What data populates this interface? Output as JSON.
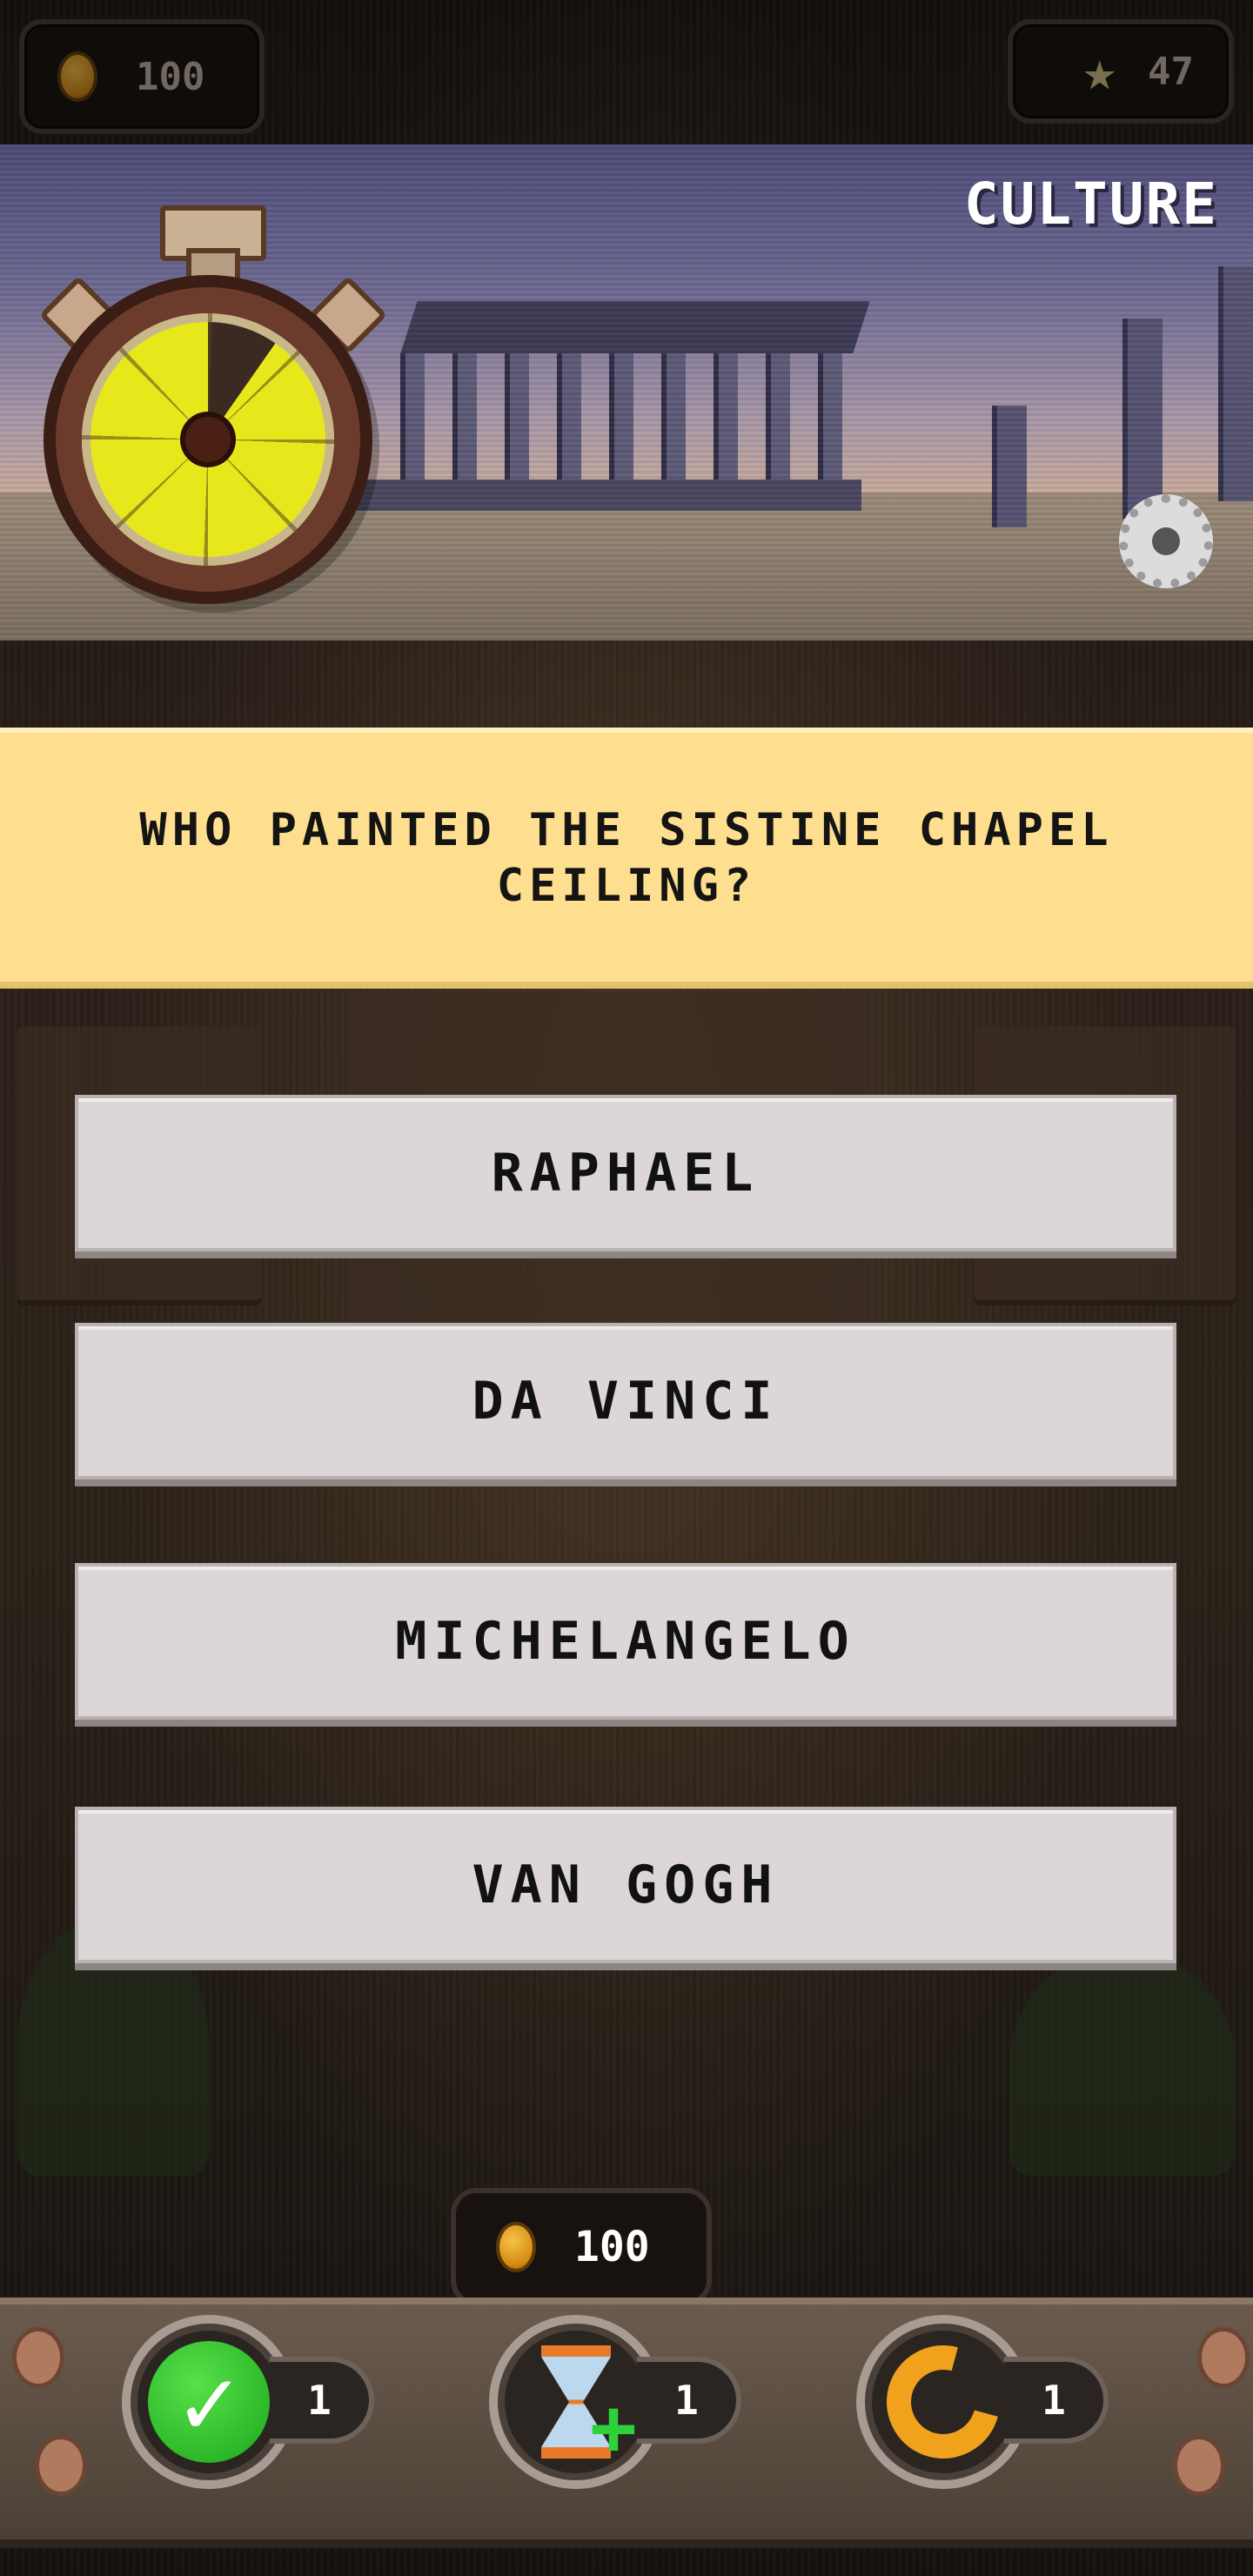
{
  "hud": {
    "coins": "100",
    "stars": "47",
    "icons": {
      "coin": "coin-icon",
      "star": "star-icon"
    }
  },
  "banner": {
    "category": "CULTURE",
    "scene": "parthenon-ruins",
    "timer": {
      "icon": "stopwatch-icon",
      "remaining_fraction": 0.9
    },
    "settings_icon": "gear-icon"
  },
  "question": {
    "text": "WHO PAINTED THE SISTINE CHAPEL CEILING?"
  },
  "answers": [
    {
      "label": "RAPHAEL"
    },
    {
      "label": "DA VINCI"
    },
    {
      "label": "MICHELANGELO"
    },
    {
      "label": "VAN GOGH"
    }
  ],
  "powerups": {
    "cost": "100",
    "items": [
      {
        "icon": "checkmark-icon",
        "count": "1"
      },
      {
        "icon": "hourglass-plus-icon",
        "count": "1"
      },
      {
        "icon": "refresh-icon",
        "count": "1"
      }
    ]
  },
  "colors": {
    "question_bg": "#fddf8f",
    "answer_bg": "#dcd6d6",
    "timer_fill": "#e6e81c",
    "check_green": "#1aa81b",
    "refresh_orange": "#f0a21c"
  }
}
